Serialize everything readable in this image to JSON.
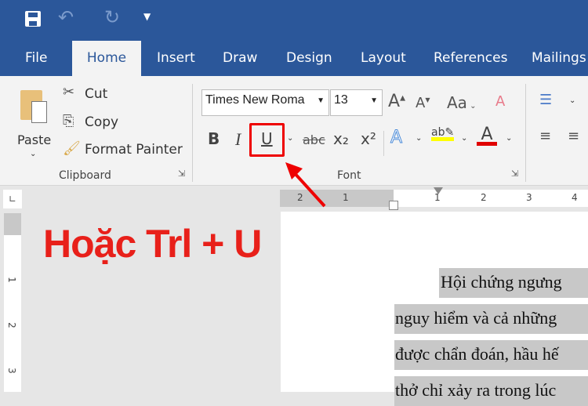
{
  "quick_access": {
    "save_icon": "floppy-disk",
    "undo_icon": "undo-arrow",
    "redo_icon": "redo-circle",
    "customize_icon": "dropdown-arrow"
  },
  "tabs": [
    {
      "label": "File"
    },
    {
      "label": "Home",
      "active": true
    },
    {
      "label": "Insert"
    },
    {
      "label": "Draw"
    },
    {
      "label": "Design"
    },
    {
      "label": "Layout"
    },
    {
      "label": "References"
    },
    {
      "label": "Mailings"
    }
  ],
  "clipboard": {
    "paste": "Paste",
    "cut": "Cut",
    "copy": "Copy",
    "format_painter": "Format Painter",
    "group": "Clipboard"
  },
  "font": {
    "name": "Times New Roma",
    "size": "13",
    "group": "Font",
    "bold": "B",
    "italic": "I",
    "underline": "U",
    "strike": "abc",
    "subscript": "x₂",
    "superscript": "x²",
    "change_case": "Aa",
    "highlight_color": "#ffff00",
    "font_color": "#e00000"
  },
  "ruler": {
    "h_ticks": [
      "2",
      "1",
      "1",
      "2",
      "3",
      "4"
    ],
    "v_ticks": [
      "1",
      "2",
      "3"
    ]
  },
  "annotation": {
    "caption": "Hoặc Trl + U",
    "highlight_color": "#e00000"
  },
  "document": {
    "lines": [
      "Hội chứng ngưng",
      "nguy hiểm và cả những",
      "được chẩn đoán, hầu hế",
      "thở chỉ xảy ra trong lúc"
    ]
  }
}
